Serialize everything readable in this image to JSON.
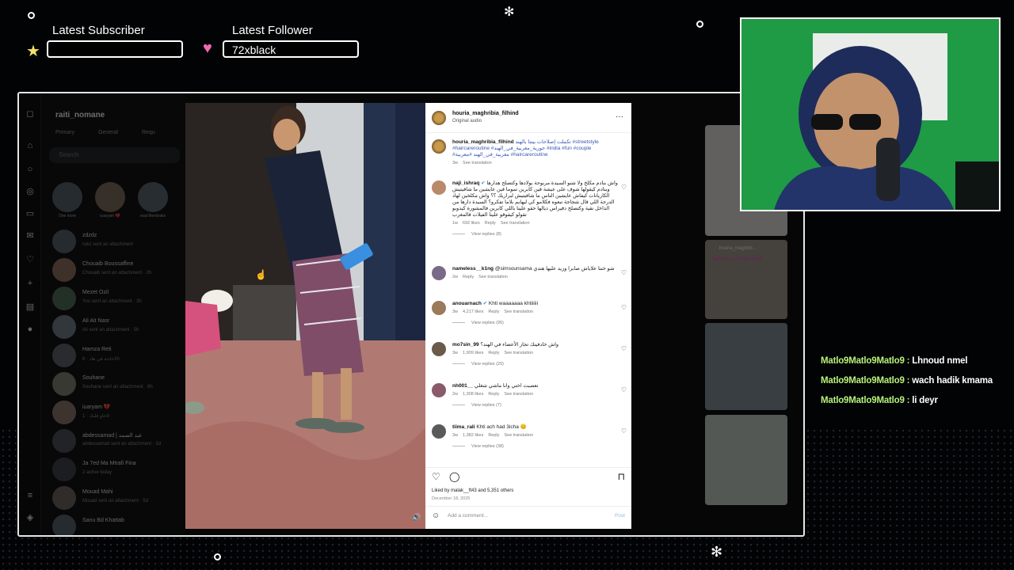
{
  "overlay": {
    "subscriber_label": "Latest Subscriber",
    "subscriber_value": "",
    "follower_label": "Latest Follower",
    "follower_value": "72xblack",
    "star_icon": "star-icon",
    "heart_icon": "heart-icon"
  },
  "dm": {
    "username": "raiti_nomane",
    "tabs": [
      "Primary",
      "General",
      "Requ"
    ],
    "search_placeholder": "Search",
    "stories": [
      {
        "name": "One more"
      },
      {
        "name": "iuaryam 💔"
      },
      {
        "name": "mad Benbraks"
      }
    ],
    "conversations": [
      {
        "name": "zdzdz",
        "msg": "rukz sent an attachment"
      },
      {
        "name": "Chouaib Boussaffine",
        "msg": "Chouaib sent an attachment · 2h"
      },
      {
        "name": "Mezet Ozil",
        "msg": "You sent an attachment · 3h"
      },
      {
        "name": "Ali Ait Nasr",
        "msg": "Ali sent an attachment · 5h"
      },
      {
        "name": "Hamza Reti",
        "msg": "لاحاجة في هاد · 6h"
      },
      {
        "name": "Souhane",
        "msg": "Souhane sent an attachment · 8h"
      },
      {
        "name": "iuaryam 💔",
        "msg": "خاو قلبك · 1d"
      },
      {
        "name": "abdessamad | عبد الصمد",
        "msg": "abdessamad sent an attachment · 3d"
      },
      {
        "name": "Ja 7ed Ma Mtrafi Fina",
        "msg": "2 active today"
      },
      {
        "name": "Mouad Mahi",
        "msg": "Mouad sent an attachment · 5d"
      },
      {
        "name": "Sanu Bd Khattab",
        "msg": ""
      }
    ]
  },
  "post": {
    "author": "houria_maghribia_filhind",
    "audio": "Original audio",
    "caption_user": "houria_maghribia_filhind",
    "caption": "تكملت إصلاحات بيتنا بالهند #streetstyle #haircareroutine #حورية_مغربية_في_الهند #india #fun #couple #مغربية_في_الهند #معربية #haircareroutine",
    "caption_meta": "3w",
    "see_translation": "See translation",
    "comments": [
      {
        "user": "naji_ishraq",
        "verified": true,
        "text": "واش بنادم مكلخ ولا شنو السيدة مربوحة بولادها وكتصلح هدارها وبنادم كيقولها شوف على عيشة فين كابرين تموما فين عايشين ما شافيتيش الكاريانات كيفاش عايشين الناس ما شافيتيش لبراريك ؟؟ واش مكلخين لهاد الدرجة اللي قال شجاجة تبعوه فكلامو كي ليهايم بلاما تفكرو؟ السيدة دارها من الداخل نقية وكتصلح دقيراس ديالها حقو علينا باللي كابرين فالمشورة كيدوبو تقولو كيفوقو علينا الفيلات فالمغرب",
        "time": "1w",
        "likes": "692 likes",
        "replies": "View replies (8)"
      },
      {
        "user": "nameless__k1ng",
        "verified": false,
        "text": "@simsounsama شو ختنا علاياش صابرا وزيد عليها هندي",
        "time": "2w",
        "likes": "",
        "replies": ""
      },
      {
        "user": "anouarnach",
        "verified": true,
        "text": "Khti waaaaaaa khtiiiiii",
        "time": "3w",
        "likes": "4,217 likes",
        "replies": "View replies (95)"
      },
      {
        "user": "mo7sin_99",
        "verified": false,
        "text": "واش خادفينك تجاز الأعضاء في الهند؟",
        "time": "3w",
        "likes": "1,909 likes",
        "replies": "View replies (20)"
      },
      {
        "user": "nh001__",
        "verified": false,
        "text": "تعصبت اختي وانا ماشي شغلي",
        "time": "2w",
        "likes": "1,308 likes",
        "replies": "View replies (7)"
      },
      {
        "user": "tiima_rali",
        "verified": false,
        "text": "Khti ach had 3icha 😊",
        "time": "3w",
        "likes": "1,382 likes",
        "replies": "View replies (38)"
      }
    ],
    "reply": "Reply",
    "liked_by": "Liked by malak__ft43 and 5,351 others",
    "date": "December 18, 2025",
    "add_comment_placeholder": "Add a comment...",
    "post_button": "Post"
  },
  "right_strip": {
    "tile_user": "houria_maghrib...",
    "tile_caption": "تكملت إصلاحات بيتنا بالهند"
  },
  "chat": [
    {
      "user": "Matlo9Matlo9Matlo9 :",
      "msg": "Lhnoud nmel"
    },
    {
      "user": "Matlo9Matlo9Matlo9 :",
      "msg": "wach hadik kmama"
    },
    {
      "user": "Matlo9Matlo9Matlo9 :",
      "msg": "li deyr"
    }
  ]
}
